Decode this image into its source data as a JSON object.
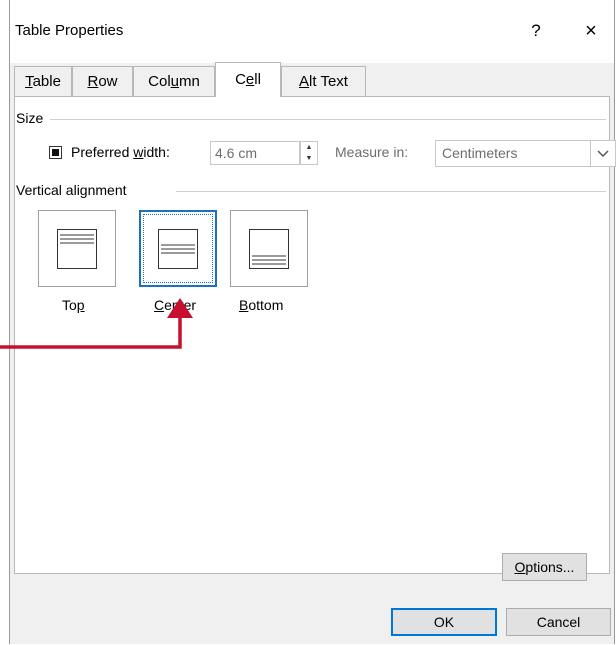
{
  "dialog": {
    "title": "Table Properties",
    "help": "?",
    "close": "×"
  },
  "tabs": [
    {
      "pre": "",
      "u": "T",
      "post": "able"
    },
    {
      "pre": "",
      "u": "R",
      "post": "ow"
    },
    {
      "pre": "Col",
      "u": "u",
      "post": "mn"
    },
    {
      "pre": "C",
      "u": "e",
      "post": "ll"
    },
    {
      "pre": "",
      "u": "A",
      "post": "lt Text"
    }
  ],
  "active_tab_index": 3,
  "size": {
    "group_title": "Size",
    "preferred_width_pre": "Preferred ",
    "preferred_width_u": "w",
    "preferred_width_post": "idth:",
    "preferred_width_checked": true,
    "width_value": "4.6 cm",
    "measure_label": "Measure in:",
    "measure_value": "Centimeters"
  },
  "vertical_alignment": {
    "group_title": "Vertical alignment",
    "options": [
      {
        "pre": "To",
        "u": "p",
        "post": ""
      },
      {
        "pre": "",
        "u": "C",
        "post": "enter"
      },
      {
        "pre": "",
        "u": "B",
        "post": "ottom"
      }
    ],
    "selected": "Center"
  },
  "buttons": {
    "options_u": "O",
    "options_post": "ptions...",
    "ok": "OK",
    "cancel": "Cancel"
  },
  "colors": {
    "annotation_arrow": "#c8102e",
    "focus": "#1e6fbf",
    "default_button_border": "#0078d7"
  }
}
